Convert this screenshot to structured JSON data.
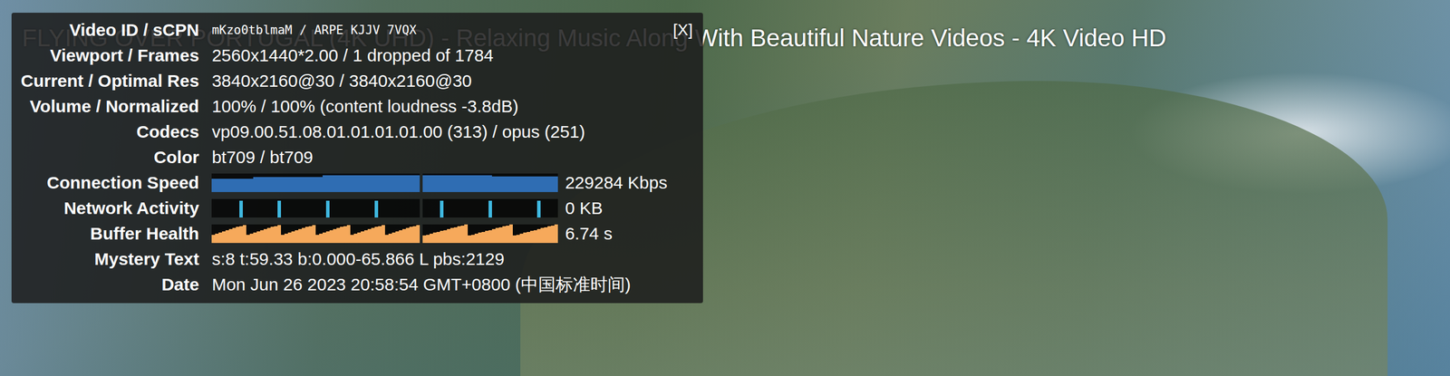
{
  "video": {
    "title": "FLYING OVER PORTUGAL (4K UHD) - Relaxing Music Along With Beautiful Nature Videos - 4K Video HD"
  },
  "stats": {
    "close": "[X]",
    "rows": [
      {
        "kind": "id",
        "label": "Video ID / sCPN",
        "value": "mKzo0tblmaM / ARPE KJJV 7VQX"
      },
      {
        "kind": "text",
        "label": "Viewport / Frames",
        "value": "2560x1440*2.00 / 1 dropped of 1784"
      },
      {
        "kind": "text",
        "label": "Current / Optimal Res",
        "value": "3840x2160@30 / 3840x2160@30"
      },
      {
        "kind": "text",
        "label": "Volume / Normalized",
        "value": "100% / 100% (content loudness -3.8dB)"
      },
      {
        "kind": "text",
        "label": "Codecs",
        "value": "vp09.00.51.08.01.01.01.01.00 (313) / opus (251)"
      },
      {
        "kind": "text",
        "label": "Color",
        "value": "bt709 / bt709"
      },
      {
        "kind": "graph",
        "label": "Connection Speed",
        "value": "229284 Kbps",
        "color": "#2f6db3",
        "charts": [
          {
            "values": [
              0.72,
              0.72,
              0.72,
              0.72,
              0.72,
              0.72,
              0.72,
              0.72,
              0.72,
              0.72,
              0.72,
              0.72,
              0.8,
              0.8,
              0.8,
              0.8,
              0.8,
              0.8,
              0.8,
              0.8,
              0.8,
              0.8,
              0.8,
              0.8,
              0.8,
              0.8,
              0.8,
              0.8,
              0.8,
              0.8,
              0.8,
              0.8,
              0.9,
              0.9,
              0.9,
              0.9,
              0.9,
              0.9,
              0.9,
              0.9,
              0.9,
              0.9,
              0.9,
              0.9,
              0.9,
              0.9,
              0.9,
              0.9,
              0.9,
              0.9,
              0.9,
              0.9,
              0.9,
              0.9,
              0.9,
              0.9,
              0.9,
              0.9,
              0.9,
              0.9
            ]
          },
          {
            "values": [
              0.9,
              0.9,
              0.9,
              0.9,
              0.9,
              0.9,
              0.9,
              0.9,
              0.9,
              0.9,
              0.9,
              0.9,
              0.9,
              0.9,
              0.9,
              0.9,
              0.9,
              0.9,
              0.9,
              0.9,
              0.84,
              0.84,
              0.84,
              0.84,
              0.84,
              0.84,
              0.84,
              0.84,
              0.84,
              0.84,
              0.84,
              0.84,
              0.84,
              0.84,
              0.84,
              0.84,
              0.84,
              0.84,
              0.84
            ]
          }
        ]
      },
      {
        "kind": "graph",
        "label": "Network Activity",
        "value": "0 KB",
        "color": "#3fb8e0",
        "charts": [
          {
            "values": [
              0,
              0,
              0,
              0,
              0,
              0,
              0,
              0,
              0.9,
              0,
              0,
              0,
              0,
              0,
              0,
              0,
              0,
              0,
              0,
              0.9,
              0,
              0,
              0,
              0,
              0,
              0,
              0,
              0,
              0,
              0,
              0,
              0,
              0,
              0.9,
              0,
              0,
              0,
              0,
              0,
              0,
              0,
              0,
              0,
              0,
              0,
              0,
              0,
              0.9,
              0,
              0,
              0,
              0,
              0,
              0,
              0,
              0,
              0,
              0,
              0,
              0
            ]
          },
          {
            "values": [
              0,
              0,
              0,
              0,
              0,
              0.9,
              0,
              0,
              0,
              0,
              0,
              0,
              0,
              0,
              0,
              0,
              0,
              0,
              0,
              0.9,
              0,
              0,
              0,
              0,
              0,
              0,
              0,
              0,
              0,
              0,
              0,
              0,
              0,
              0.9,
              0,
              0,
              0,
              0,
              0
            ]
          }
        ]
      },
      {
        "kind": "graph",
        "label": "Buffer Health",
        "value": "6.74 s",
        "color": "#f6a95b",
        "charts": [
          {
            "values": [
              0.45,
              0.5,
              0.56,
              0.62,
              0.68,
              0.74,
              0.8,
              0.86,
              0.92,
              0.98,
              0.45,
              0.5,
              0.56,
              0.62,
              0.68,
              0.74,
              0.8,
              0.86,
              0.92,
              0.98,
              0.45,
              0.5,
              0.56,
              0.62,
              0.68,
              0.74,
              0.8,
              0.86,
              0.92,
              0.98,
              0.45,
              0.5,
              0.56,
              0.62,
              0.68,
              0.74,
              0.8,
              0.86,
              0.92,
              0.98,
              0.45,
              0.5,
              0.56,
              0.62,
              0.68,
              0.74,
              0.8,
              0.86,
              0.92,
              0.98,
              0.45,
              0.5,
              0.56,
              0.62,
              0.68,
              0.74,
              0.8,
              0.86,
              0.92,
              0.98
            ]
          },
          {
            "values": [
              0.4,
              0.45,
              0.5,
              0.55,
              0.6,
              0.65,
              0.7,
              0.75,
              0.8,
              0.85,
              0.9,
              0.95,
              1,
              0.4,
              0.45,
              0.5,
              0.55,
              0.6,
              0.65,
              0.7,
              0.75,
              0.8,
              0.85,
              0.9,
              0.95,
              1,
              0.4,
              0.45,
              0.5,
              0.55,
              0.6,
              0.65,
              0.7,
              0.75,
              0.8,
              0.85,
              0.9,
              0.95,
              1
            ]
          }
        ]
      },
      {
        "kind": "text",
        "label": "Mystery Text",
        "value": "s:8 t:59.33 b:0.000-65.866 L pbs:2129"
      },
      {
        "kind": "text",
        "label": "Date",
        "value": "Mon Jun 26 2023 20:58:54 GMT+0800 (中国标准时间)"
      }
    ]
  }
}
